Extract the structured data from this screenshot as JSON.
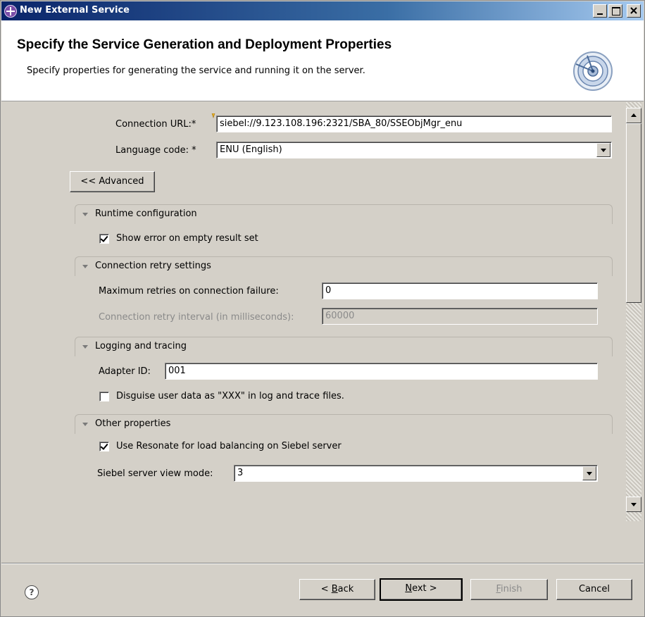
{
  "window": {
    "title": "New External Service"
  },
  "header": {
    "title": "Specify the Service Generation and Deployment Properties",
    "description": "Specify properties for generating the service and running it on the server."
  },
  "connection": {
    "url_label": "Connection URL:*",
    "url_value": "siebel://9.123.108.196:2321/SBA_80/SSEObjMgr_enu",
    "language_label": "Language code: *",
    "language_value": "ENU (English)"
  },
  "advanced_button": "<< Advanced",
  "sections": {
    "runtime": {
      "label": "Runtime configuration",
      "show_error_label": "Show error on empty result set",
      "show_error_checked": true
    },
    "retry": {
      "label": "Connection retry settings",
      "max_retries_label": "Maximum retries on connection failure:",
      "max_retries_value": "0",
      "interval_label": "Connection retry interval (in milliseconds):",
      "interval_value": "60000"
    },
    "logging": {
      "label": "Logging and tracing",
      "adapter_id_label": "Adapter ID:",
      "adapter_id_value": "001",
      "disguise_label": "Disguise user data as \"XXX\" in log and trace files.",
      "disguise_checked": false
    },
    "other": {
      "label": "Other properties",
      "resonate_label": "Use Resonate for load balancing on Siebel server",
      "resonate_checked": true,
      "view_mode_label": "Siebel server view mode:",
      "view_mode_value": "3"
    }
  },
  "footer": {
    "help": "?",
    "back_rest": "ack",
    "back_prefix": "< ",
    "back_mnemonic": "B",
    "next_mnemonic": "N",
    "next_rest": "ext >",
    "finish_mnemonic": "F",
    "finish_rest": "inish",
    "cancel": "Cancel"
  }
}
